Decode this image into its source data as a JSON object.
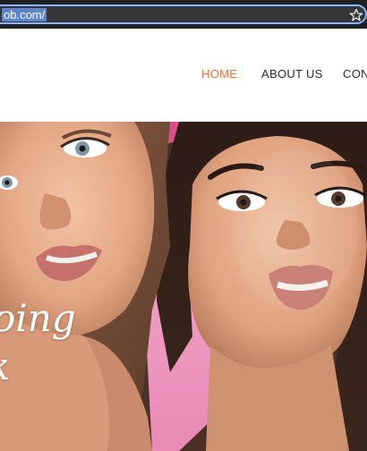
{
  "browser": {
    "url": "ob.com/",
    "bookmark_icon": "star-icon"
  },
  "nav": {
    "items": [
      {
        "label": "HOME",
        "active": true
      },
      {
        "label": "ABOUT US",
        "active": false
      },
      {
        "label": "CONT",
        "active": false
      }
    ],
    "active_color": "#e8743b"
  },
  "hero": {
    "headline_line1": "oing",
    "headline_line2": "k"
  }
}
